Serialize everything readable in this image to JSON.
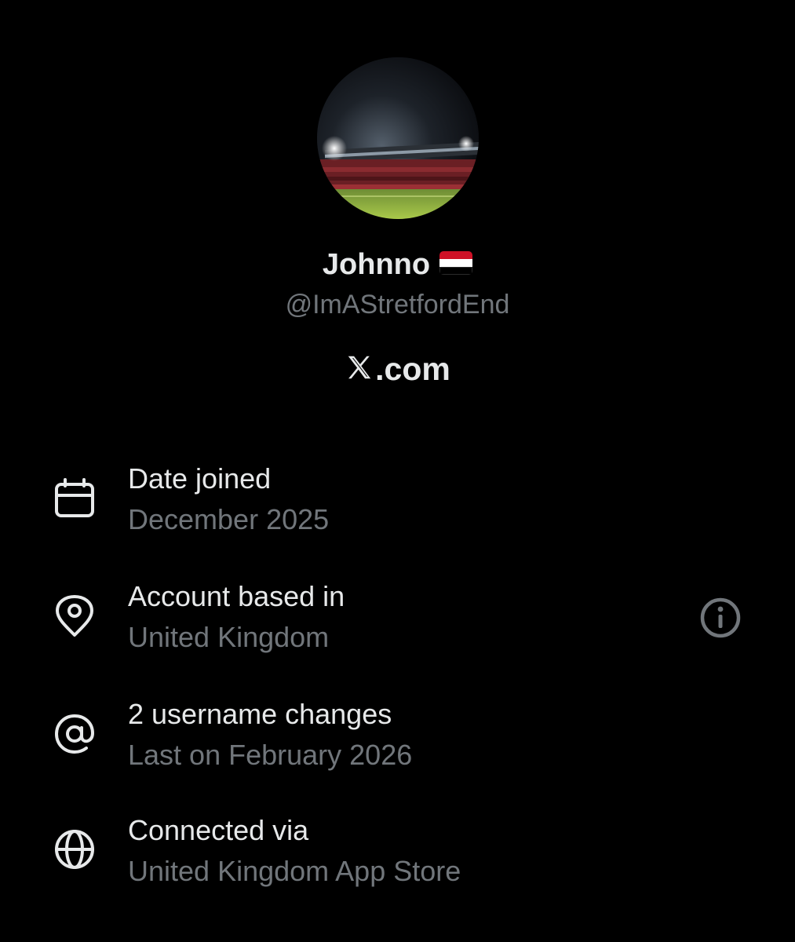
{
  "profile": {
    "display_name": "Johnno",
    "flag": "yemen-flag",
    "handle": "@ImAStretfordEnd",
    "site": ".com",
    "site_logo": "x-logo"
  },
  "about": [
    {
      "icon": "calendar-icon",
      "title": "Date joined",
      "subtitle": "December 2025"
    },
    {
      "icon": "location-pin-icon",
      "title": "Account based in",
      "subtitle": "United Kingdom",
      "action_icon": "info-icon"
    },
    {
      "icon": "at-sign-icon",
      "title": "2 username changes",
      "subtitle": "Last on February 2026"
    },
    {
      "icon": "globe-icon",
      "title": "Connected via",
      "subtitle": "United Kingdom App Store"
    }
  ],
  "colors": {
    "background": "#000000",
    "primary_text": "#e7e9ea",
    "secondary_text": "#71767b"
  }
}
